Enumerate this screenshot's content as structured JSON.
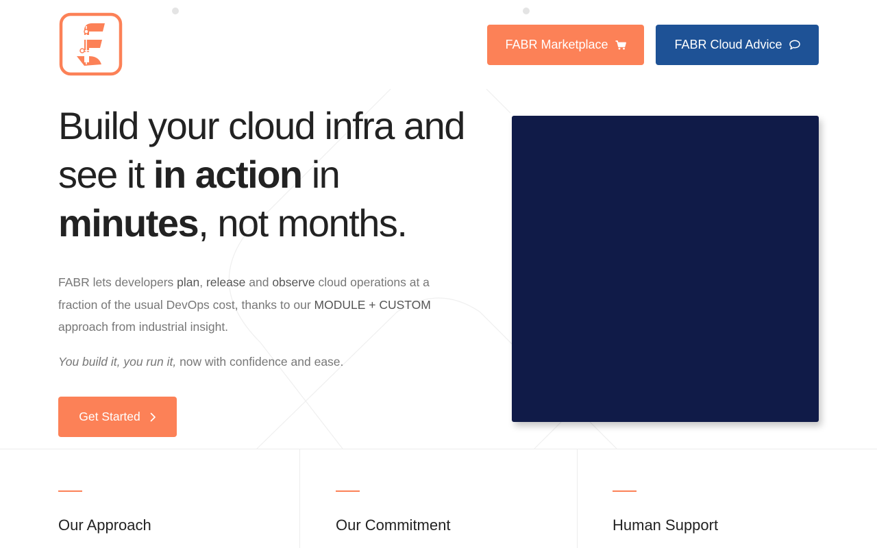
{
  "header": {
    "logo_icon": "fabr-logo-icon",
    "marketplace_label": "FABR Marketplace",
    "marketplace_icon": "cart-icon",
    "advice_label": "FABR Cloud Advice",
    "advice_icon": "chat-bubble-icon"
  },
  "hero": {
    "headline": {
      "part1": "Build your cloud infra and see it ",
      "bold1": "in action",
      "part2": " in ",
      "bold2": "minutes",
      "part3": ", not months."
    },
    "description": {
      "t1": "FABR lets developers ",
      "b1": "plan",
      "t2": ", ",
      "b2": "release",
      "t3": " and ",
      "b3": "observe",
      "t4": " cloud operations at a fraction of the usual DevOps cost, thanks to our ",
      "b4": "MODULE + CUSTOM",
      "t5": " approach from industrial insight."
    },
    "tagline": {
      "italic": "You build it, you run it,",
      "rest": " now with confidence and ease."
    },
    "cta_label": "Get Started",
    "cta_icon": "chevron-right-icon"
  },
  "features": [
    {
      "title": "Our Approach"
    },
    {
      "title": "Our Commitment"
    },
    {
      "title": "Human Support"
    }
  ],
  "colors": {
    "brand_orange": "#fc8157",
    "brand_blue": "#1e5296",
    "video_bg": "#101b48",
    "text_dark": "#222222",
    "text_muted": "#777777"
  }
}
